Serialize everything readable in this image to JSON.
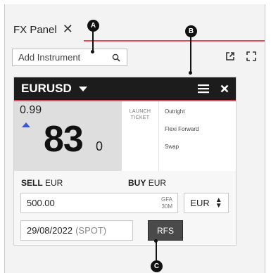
{
  "tab": {
    "title": "FX Panel",
    "close_glyph": "✕"
  },
  "toolbar": {
    "search_placeholder": "Add Instrument",
    "icons": [
      "search-icon",
      "popout-icon",
      "fullscreen-icon"
    ]
  },
  "tile": {
    "pair": "EURUSD",
    "price": {
      "big_figure": "0.99",
      "pips": "83",
      "fractional": "0",
      "direction": "up"
    },
    "launch_ticket": [
      "LAUNCH",
      "TICKET"
    ],
    "options": [
      "Outright",
      "Flexi Forward",
      "Swap"
    ],
    "sell_label": {
      "side": "SELL",
      "ccy": "EUR"
    },
    "buy_label": {
      "side": "BUY",
      "ccy": "EUR"
    },
    "amount": "500.00",
    "tenor": [
      "GFA",
      "30M"
    ],
    "currency": "EUR",
    "date": "29/08/2022",
    "date_tag": "(SPOT)",
    "rfs_label": "RFS"
  },
  "callouts": {
    "a": "A",
    "b": "B",
    "c": "C"
  },
  "colors": {
    "accent": "#e04b54",
    "header": "#1c1c1c",
    "up_arrow": "#3a59d1",
    "rfs": "#4a4a4a"
  }
}
